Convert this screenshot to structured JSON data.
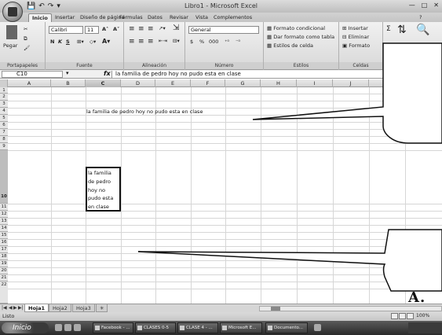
{
  "window": {
    "title": "Libro1 - Microsoft Excel"
  },
  "qat": {
    "save": "💾",
    "undo": "↶",
    "redo": "↷",
    "more": "▾"
  },
  "ribbon_tabs": [
    "Inicio",
    "Insertar",
    "Diseño de página",
    "Fórmulas",
    "Datos",
    "Revisar",
    "Vista",
    "Complementos"
  ],
  "ribbon": {
    "clipboard": {
      "label": "Portapapeles",
      "paste": "Pegar"
    },
    "font": {
      "label": "Fuente",
      "name": "Calibri",
      "size": "11",
      "bold": "N",
      "italic": "K",
      "underline": "S"
    },
    "alignment": {
      "label": "Alineación"
    },
    "number": {
      "label": "Número",
      "format": "General",
      "currency": "$",
      "percent": "%",
      "thousands": "000"
    },
    "styles": {
      "label": "Estilos",
      "conditional": "Formato condicional",
      "as_table": "Dar formato como tabla",
      "cell_styles": "Estilos de celda"
    },
    "cells": {
      "label": "Celdas",
      "insert": "Insertar",
      "delete": "Eliminar",
      "format": "Formato"
    },
    "editing": {
      "sigma": "Σ"
    }
  },
  "formula_bar": {
    "name_box": "C10",
    "fx": "fx",
    "content": "la familia de pedro hoy no pudo esta en clase"
  },
  "columns": [
    "A",
    "B",
    "C",
    "D",
    "E",
    "F",
    "G",
    "H",
    "I",
    "J"
  ],
  "rows": [
    "1",
    "2",
    "3",
    "4",
    "5",
    "6",
    "7",
    "8",
    "9",
    "10",
    "11",
    "12",
    "13",
    "14",
    "15",
    "16",
    "17",
    "18",
    "19",
    "20",
    "21",
    "22"
  ],
  "cells": {
    "C3": "la familia de pedro hoy no pudo esta en clase",
    "C10_lines": [
      "la familia",
      "de pedro",
      "hoy no",
      "pudo esta",
      "en clase"
    ]
  },
  "sheets": {
    "tabs": [
      "Hoja1",
      "Hoja2",
      "Hoja3"
    ],
    "active": "Hoja1"
  },
  "status": {
    "mode": "Listo",
    "zoom": "100%"
  },
  "taskbar": {
    "start": "Inicio",
    "items": [
      "Facebook - ...",
      "CLASES 0-5",
      "CLASE 4 - ...",
      "Microsoft E...",
      "Documento..."
    ]
  },
  "annotation": {
    "letter": "A."
  }
}
